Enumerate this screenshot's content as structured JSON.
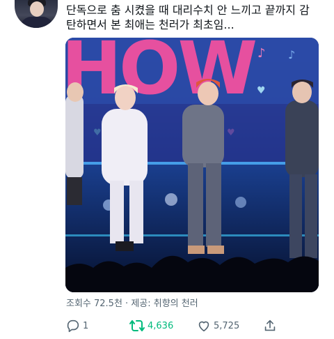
{
  "tweet": {
    "text_lines": [
      "단독으로 춤 시켰을 때 대리수치 안 느끼고 끝까지 감",
      "탄하면서 본 최애는 천러가 최초임..."
    ]
  },
  "media": {
    "stage_sign_text": "HOW"
  },
  "meta": {
    "views_line": "조회수 72.5천 · 제공: 취향의 천러"
  },
  "actions": {
    "reply_count": "1",
    "retweet_count": "4,636",
    "like_count": "5,725"
  },
  "icons": {
    "reply": "reply-icon",
    "retweet": "retweet-icon",
    "like": "heart-icon",
    "share": "share-icon"
  },
  "colors": {
    "text": "#0f1419",
    "muted": "#536471",
    "retweet_active": "#00ba7c",
    "stage_sign_pink": "#e6509f"
  }
}
